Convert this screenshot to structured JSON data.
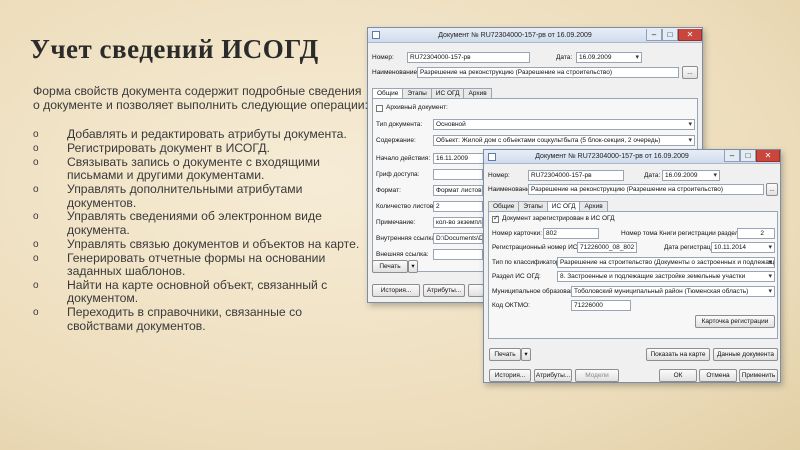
{
  "slide": {
    "title": "Учет сведений ИСОГД",
    "intro": "Форма свойств документа содержит подробные сведения о документе и позволяет выполнить следующие операции:",
    "bullet_glyph": "o",
    "operations": [
      "Добавлять и редактировать атрибуты документа.",
      "Регистрировать документ в ИСОГД.",
      "Связывать запись о документе с входящими письмами и другими документами.",
      "Управлять дополнительными атрибутами документов.",
      "Управлять сведениями об электронном виде документа.",
      "Управлять связью документов и объектов на карте.",
      "Генерировать отчетные формы на основании заданных шаблонов.",
      "Найти на карте основной объект, связанный с документом.",
      "Переходить в справочники, связанные со свойствами документов."
    ]
  },
  "win1": {
    "title": "Документ № RU72304000-157-рв от 16.09.2009",
    "number_label": "Номер:",
    "number_value": "RU72304000-157-рв",
    "date_label": "Дата:",
    "date_value": "16.09.2009",
    "name_label": "Наименование:",
    "name_value": "Разрешение на реконструкцию (Разрешение на строительство)",
    "tabs": [
      "Общие",
      "Этапы",
      "ИС ОГД",
      "Архив"
    ],
    "archive_label": "Архивный документ:",
    "doctype_label": "Тип документа:",
    "doctype_value": "Основной",
    "content_label": "Содержание:",
    "content_value": "Объект: Жилой дом с объектами соцкультбыта (5 блок-секция, 2 очередь)",
    "start_label": "Начало действия:",
    "start_value": "16.11.2009",
    "grif_label": "Гриф доступа:",
    "format_label": "Формат:",
    "format_value": "Формат листов А",
    "sheets_label": "Количество листов:",
    "sheets_value": "2",
    "note_label": "Примечание:",
    "note_value": "кол-во экземпляр",
    "inner_label": "Внутренняя ссылка:",
    "inner_value": "D:\\Documents\\Do",
    "outer_label": "Внешняя ссылка:",
    "print_label": "Печать",
    "history_label": "История...",
    "attrs_label": "Атрибуты..."
  },
  "win2": {
    "title": "Документ № RU72304000-157-рв от 16.09.2009",
    "number_label": "Номер:",
    "number_value": "RU72304000-157-рв",
    "date_label": "Дата:",
    "date_value": "16.09.2009",
    "name_label": "Наименование:",
    "name_value": "Разрешение на реконструкцию (Разрешение на строительство)",
    "tabs": [
      "Общие",
      "Этапы",
      "ИС ОГД",
      "Архив"
    ],
    "registered_label": "Документ зарегистрирован в ИС ОГД",
    "card_no_label": "Номер карточки:",
    "card_no_value": "802",
    "volume_label": "Номер тома Книги регистрации раздела:",
    "volume_value": "2",
    "reg_no_label": "Регистрационный номер ИС ОГД:",
    "reg_no_value": "71226000_08_802",
    "reg_date_label": "Дата регистрации:",
    "reg_date_value": "10.11.2014",
    "classifier_label": "Тип по классификатору:",
    "classifier_value": "Разрешение на строительство (Документы о застроенных и подлежащих зас",
    "section_label": "Раздел ИС ОГД:",
    "section_value": "8. Застроенные и подлежащие застройке земельные участки",
    "municipality_label": "Муниципальное образование:",
    "municipality_value": "Тоболовский муниципальный район (Тюменская область)",
    "oktmo_label": "Код ОКТМО:",
    "oktmo_value": "71226000",
    "reg_card_label": "Карточка регистрации",
    "print_label": "Печать",
    "show_map_label": "Показать на карте",
    "doc_data_label": "Данные документа",
    "history_label": "История...",
    "attrs_label": "Атрибуты...",
    "models_label": "Модели",
    "ok_label": "ОК",
    "cancel_label": "Отмена",
    "apply_label": "Применить"
  }
}
